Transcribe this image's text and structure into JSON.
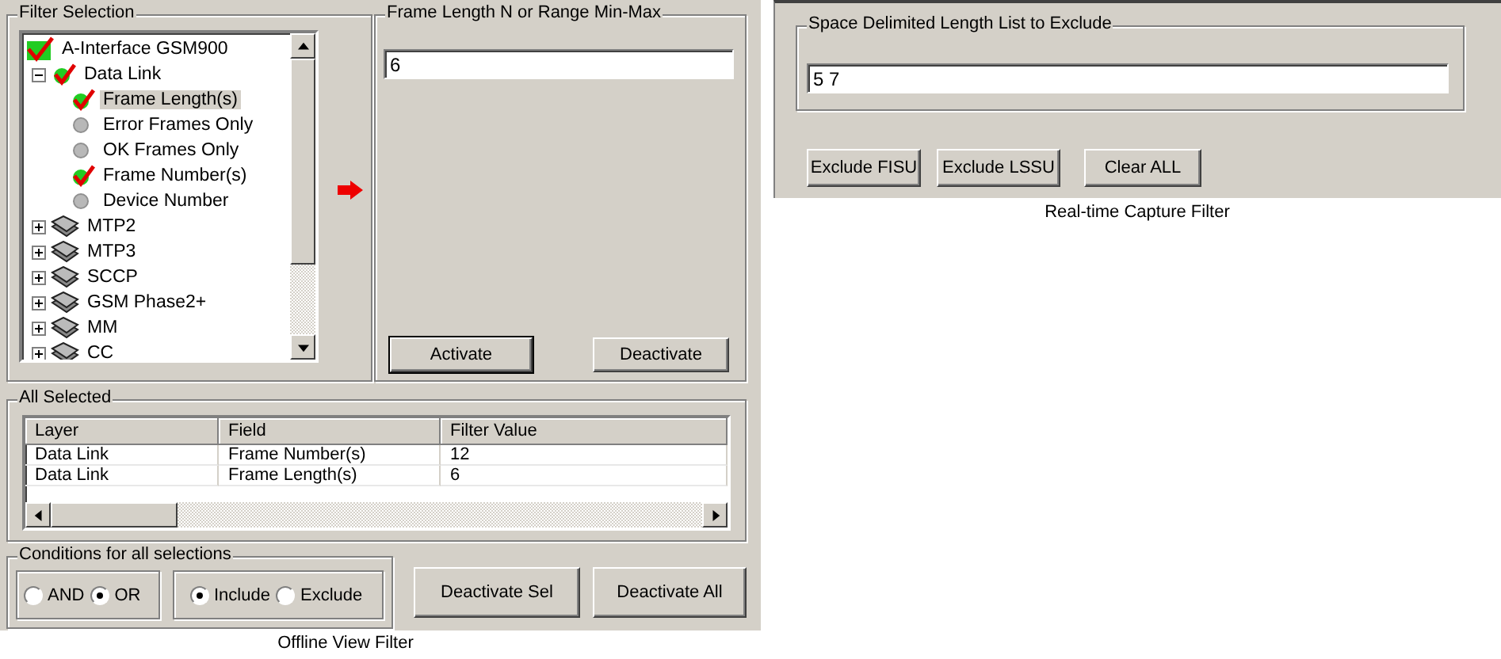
{
  "offline_view_filter": {
    "caption": "Offline View Filter",
    "filter_selection": {
      "title": "Filter Selection",
      "tree": [
        {
          "kind": "interface",
          "label": "A-Interface GSM900",
          "checked": true,
          "selected": false,
          "children": [
            {
              "kind": "layer",
              "label": "Data Link",
              "checked": true,
              "expanded": true,
              "selected": false,
              "children": [
                {
                  "kind": "field",
                  "label": "Frame Length(s)",
                  "checked": true,
                  "selected": true
                },
                {
                  "kind": "field",
                  "label": "Error Frames Only",
                  "checked": false,
                  "selected": false
                },
                {
                  "kind": "field",
                  "label": "OK Frames Only",
                  "checked": false,
                  "selected": false
                },
                {
                  "kind": "field",
                  "label": "Frame Number(s)",
                  "checked": true,
                  "selected": false
                },
                {
                  "kind": "field",
                  "label": "Device Number",
                  "checked": false,
                  "selected": false
                }
              ]
            },
            {
              "kind": "layer",
              "label": "MTP2",
              "checked": false,
              "expanded": false,
              "selected": false
            },
            {
              "kind": "layer",
              "label": "MTP3",
              "checked": false,
              "expanded": false,
              "selected": false
            },
            {
              "kind": "layer",
              "label": "SCCP",
              "checked": false,
              "expanded": false,
              "selected": false
            },
            {
              "kind": "layer",
              "label": "GSM Phase2+",
              "checked": false,
              "expanded": false,
              "selected": false
            },
            {
              "kind": "layer",
              "label": "MM",
              "checked": false,
              "expanded": false,
              "selected": false
            },
            {
              "kind": "layer",
              "label": "CC",
              "checked": false,
              "expanded": false,
              "selected": false
            }
          ]
        }
      ]
    },
    "range_box": {
      "title": "Frame Length N or Range Min-Max",
      "value": "6",
      "buttons": [
        {
          "label": "Activate",
          "default": true
        },
        {
          "label": "Deactivate",
          "default": false
        }
      ]
    },
    "all_selected": {
      "title": "All Selected",
      "columns": [
        "Layer",
        "Field",
        "Filter Value"
      ],
      "rows": [
        [
          "Data Link",
          "Frame Number(s)",
          "12"
        ],
        [
          "Data Link",
          "Frame Length(s)",
          "6"
        ]
      ]
    },
    "conditions": {
      "title": "Conditions for all selections",
      "logic": [
        {
          "label": "AND",
          "selected": false
        },
        {
          "label": "OR",
          "selected": true
        }
      ],
      "mode": [
        {
          "label": "Include",
          "selected": true
        },
        {
          "label": "Exclude",
          "selected": false
        }
      ]
    },
    "buttons": [
      "Deactivate Sel",
      "Deactivate All"
    ]
  },
  "realtime_capture_filter": {
    "caption": "Real-time Capture Filter",
    "exclude_list": {
      "title": "Space Delimited Length List to Exclude",
      "value": "5 7"
    },
    "buttons": [
      "Exclude FISU",
      "Exclude LSSU",
      "Clear ALL"
    ]
  }
}
